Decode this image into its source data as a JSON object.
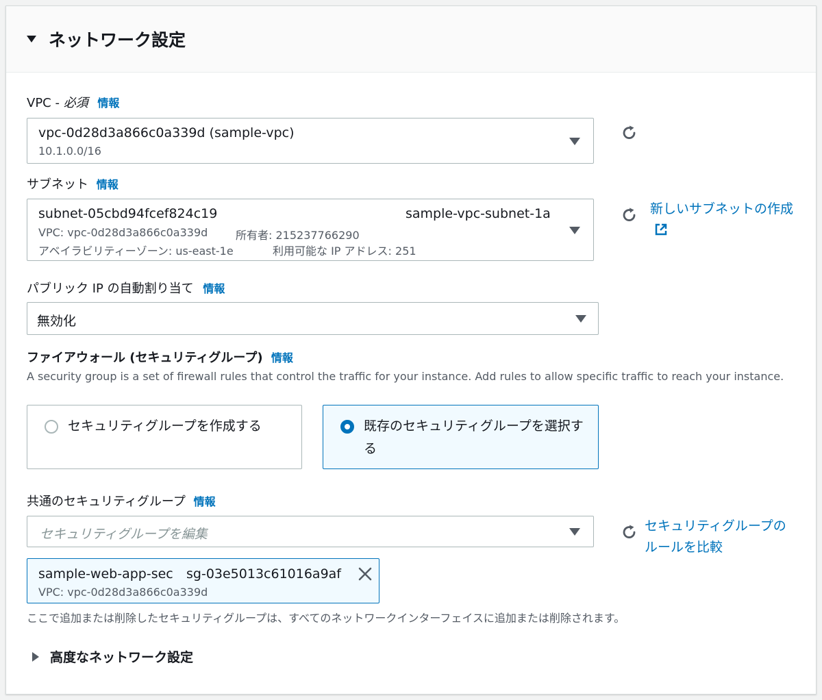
{
  "section": {
    "title": "ネットワーク設定"
  },
  "vpc": {
    "label": "VPC - ",
    "required": "必須",
    "info": "情報",
    "value": "vpc-0d28d3a866c0a339d (sample-vpc)",
    "cidr": "10.1.0.0/16"
  },
  "subnet": {
    "label": "サブネット",
    "info": "情報",
    "id": "subnet-05cbd94fcef824c19",
    "name": "sample-vpc-subnet-1a",
    "vpc": "VPC: vpc-0d28d3a866c0a339d",
    "owner": "所有者: 215237766290",
    "az": "アベイラビリティーゾーン: us-east-1e",
    "available_ips": "利用可能な IP アドレス: 251",
    "create_link": "新しいサブネットの作成"
  },
  "public_ip": {
    "label": "パブリック IP の自動割り当て",
    "info": "情報",
    "value": "無効化"
  },
  "firewall": {
    "label": "ファイアウォール (セキュリティグループ)",
    "info": "情報",
    "description": "A security group is a set of firewall rules that control the traffic for your instance. Add rules to allow specific traffic to reach your instance.",
    "option_create": "セキュリティグループを作成する",
    "option_existing": "既存のセキュリティグループを選択する",
    "selected": "option_existing"
  },
  "common_sg": {
    "label": "共通のセキュリティグループ",
    "info": "情報",
    "placeholder": "セキュリティグループを編集",
    "compare_link": "セキュリティグループのルールを比較",
    "token_name": "sample-web-app-sec",
    "token_id": "sg-03e5013c61016a9af",
    "token_vpc": "VPC: vpc-0d28d3a866c0a339d",
    "note": "ここで追加または削除したセキュリティグループは、すべてのネットワークインターフェイスに追加または削除されます。"
  },
  "advanced": {
    "title": "高度なネットワーク設定"
  },
  "colors": {
    "link": "#0073bb",
    "selected_card_bg": "#f1faff",
    "border": "#aab7b8"
  }
}
